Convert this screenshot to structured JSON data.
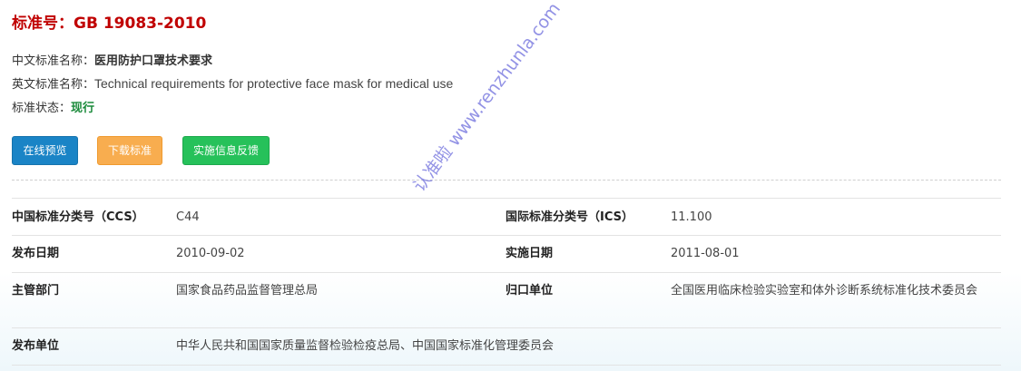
{
  "header": {
    "title": "标准号：GB 19083-2010"
  },
  "info": {
    "cn_name_label": "中文标准名称：",
    "cn_name": "医用防护口罩技术要求",
    "en_name_label": "英文标准名称：",
    "en_name": "Technical requirements for protective face mask for medical use",
    "status_label": "标准状态：",
    "status": "现行"
  },
  "buttons": {
    "preview": "在线预览",
    "download": "下载标准",
    "feedback": "实施信息反馈"
  },
  "colors": {
    "title": "#c00000",
    "status": "#1a8a3a",
    "preview_button": "#1a84c6",
    "download_button": "#f8ad4f",
    "feedback_button": "#26c15a"
  },
  "table": {
    "rows": [
      {
        "k1": "中国标准分类号（CCS）",
        "v1": "C44",
        "k2": "国际标准分类号（ICS）",
        "v2": "11.100"
      },
      {
        "k1": "发布日期",
        "v1": "2010-09-02",
        "k2": "实施日期",
        "v2": "2011-08-01"
      },
      {
        "k1": "主管部门",
        "v1": "国家食品药品监督管理总局",
        "k2": "归口单位",
        "v2": "全国医用临床检验实验室和体外诊断系统标准化技术委员会"
      },
      {
        "k1": "发布单位",
        "v1": "中华人民共和国国家质量监督检验检疫总局、中国国家标准化管理委员会"
      }
    ]
  },
  "watermark": "认准啦 www.renzhunla.com"
}
